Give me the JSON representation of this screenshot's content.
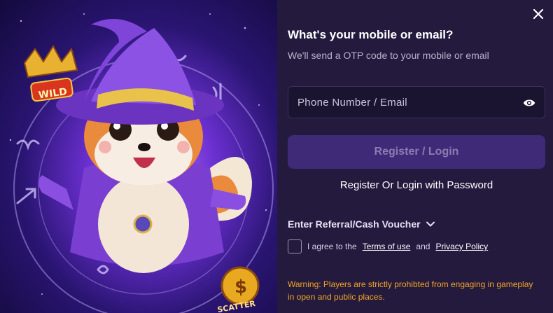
{
  "art": {
    "wild_badge": "WILD",
    "scatter_badge": "SCATTER",
    "coin_symbol": "$"
  },
  "form": {
    "title": "What's your mobile or email?",
    "subtitle": "We'll send a OTP code to your mobile or email",
    "input_placeholder": "Phone Number / Email",
    "primary_button": "Register / Login",
    "password_link": "Register Or Login with Password",
    "referral_label": "Enter Referral/Cash Voucher",
    "agree_prefix": "I agree to the",
    "terms_link": "Terms of use",
    "agree_and": "and",
    "privacy_link": "Privacy Policy",
    "warning": "Warning: Players are strictly prohibted from engaging in gameplay in open and public places."
  },
  "colors": {
    "panel_bg": "#231a3e",
    "button_bg": "#3f2a78",
    "warning": "#f5a524"
  }
}
